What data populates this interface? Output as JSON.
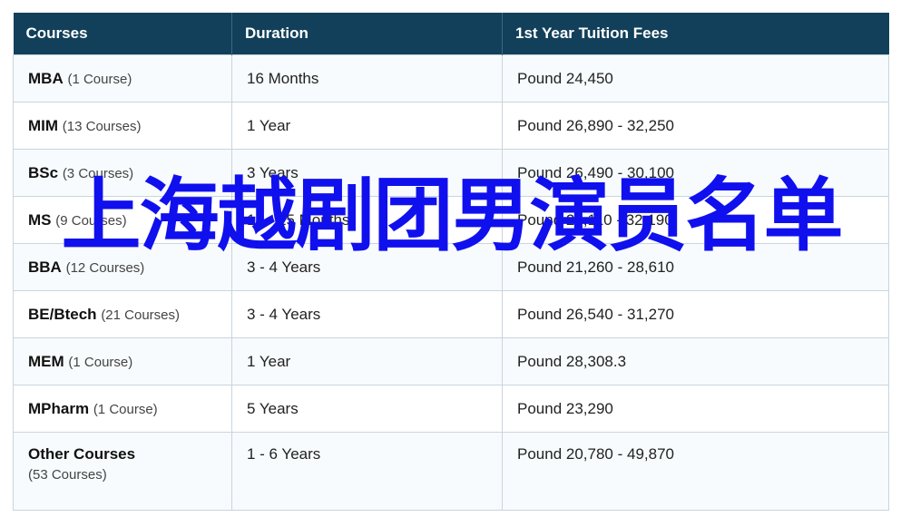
{
  "table": {
    "headers": [
      "Courses",
      "Duration",
      "1st Year Tuition Fees"
    ],
    "rows": [
      {
        "course": "MBA",
        "count": "(1 Course)",
        "duration": "16 Months",
        "fees": "Pound 24,450"
      },
      {
        "course": "MIM",
        "count": "(13 Courses)",
        "duration": "1 Year",
        "fees": "Pound 26,890 - 32,250"
      },
      {
        "course": "BSc",
        "count": "(3 Courses)",
        "duration": "3 Years",
        "fees": "Pound 26,490 - 30,100"
      },
      {
        "course": "MS",
        "count": "(9 Courses)",
        "duration": "12 - 15 Months",
        "fees": "Pound 25,110 - 32,190"
      },
      {
        "course": "BBA",
        "count": "(12 Courses)",
        "duration": "3 - 4 Years",
        "fees": "Pound 21,260 - 28,610"
      },
      {
        "course": "BE/Btech",
        "count": "(21 Courses)",
        "duration": "3 - 4 Years",
        "fees": "Pound 26,540 - 31,270"
      },
      {
        "course": "MEM",
        "count": "(1 Course)",
        "duration": "1 Year",
        "fees": "Pound 28,308.3"
      },
      {
        "course": "MPharm",
        "count": "(1 Course)",
        "duration": "5 Years",
        "fees": "Pound 23,290"
      },
      {
        "course": "Other Courses",
        "count": "(53 Courses)",
        "duration": "1 - 6 Years",
        "fees": "Pound 20,780 - 49,870"
      }
    ]
  },
  "overlay_text": "上海越剧团男演员名单",
  "colors": {
    "header_bg": "#12405a",
    "overlay": "#1010ee",
    "border": "#c9d5dd"
  }
}
